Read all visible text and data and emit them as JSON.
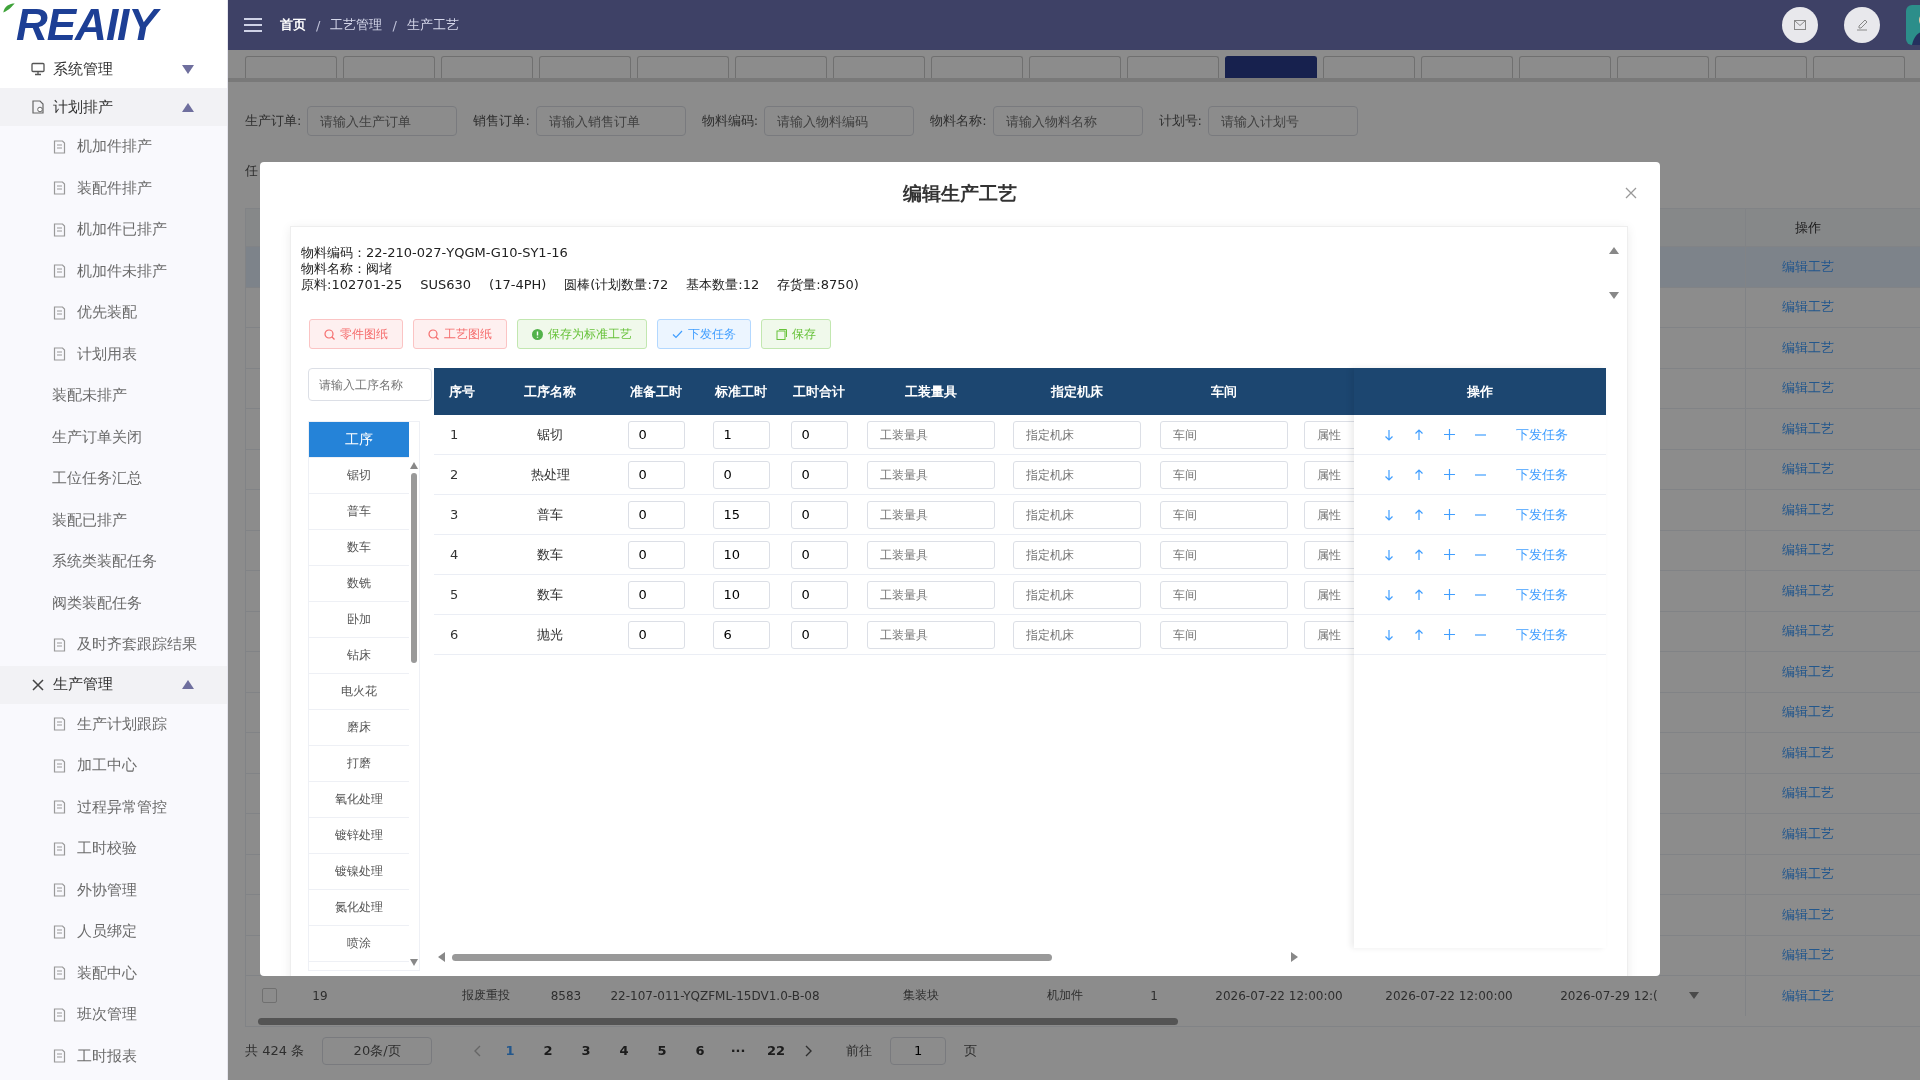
{
  "sidebar": {
    "logo": "REAIIY",
    "groups": [
      {
        "label": "系统管理",
        "expanded": false
      },
      {
        "label": "计划排产",
        "expanded": true,
        "items": [
          {
            "label": "机加件排产",
            "has_icon": true
          },
          {
            "label": "装配件排产",
            "has_icon": true
          },
          {
            "label": "机加件已排产",
            "has_icon": true
          },
          {
            "label": "机加件未排产",
            "has_icon": true
          },
          {
            "label": "优先装配",
            "has_icon": true
          },
          {
            "label": "计划用表",
            "has_icon": true
          },
          {
            "label": "装配未排产",
            "has_icon": false
          },
          {
            "label": "生产订单关闭",
            "has_icon": false
          },
          {
            "label": "工位任务汇总",
            "has_icon": false
          },
          {
            "label": "装配已排产",
            "has_icon": false
          },
          {
            "label": "系统类装配任务",
            "has_icon": false
          },
          {
            "label": "阀类装配任务",
            "has_icon": false
          },
          {
            "label": "及时齐套跟踪结果",
            "has_icon": true
          }
        ]
      },
      {
        "label": "生产管理",
        "expanded": true,
        "items": [
          {
            "label": "生产计划跟踪",
            "has_icon": true
          },
          {
            "label": "加工中心",
            "has_icon": true
          },
          {
            "label": "过程异常管控",
            "has_icon": true
          },
          {
            "label": "工时校验",
            "has_icon": true
          },
          {
            "label": "外协管理",
            "has_icon": true
          },
          {
            "label": "人员绑定",
            "has_icon": true
          },
          {
            "label": "装配中心",
            "has_icon": true
          },
          {
            "label": "班次管理",
            "has_icon": true
          },
          {
            "label": "工时报表",
            "has_icon": true
          }
        ]
      }
    ]
  },
  "breadcrumbs": [
    "首页",
    "工艺管理",
    "生产工艺"
  ],
  "breadcrumb_separators": [
    "/",
    "/"
  ],
  "tabs": [
    {
      "selected": false
    },
    {
      "selected": false
    },
    {
      "selected": false
    },
    {
      "selected": false
    },
    {
      "selected": false
    },
    {
      "selected": false
    },
    {
      "selected": false
    },
    {
      "selected": false
    },
    {
      "selected": false
    },
    {
      "selected": false
    },
    {
      "selected": true
    },
    {
      "selected": false
    },
    {
      "selected": false
    },
    {
      "selected": false
    },
    {
      "selected": false
    },
    {
      "selected": false
    },
    {
      "selected": false
    }
  ],
  "filters": [
    {
      "label": "生产订单:",
      "placeholder": "请输入生产订单"
    },
    {
      "label": "销售订单:",
      "placeholder": "请输入销售订单"
    },
    {
      "label": "物料编码:",
      "placeholder": "请输入物料编码"
    },
    {
      "label": "物料名称:",
      "placeholder": "请输入物料名称"
    },
    {
      "label": "计划号:",
      "placeholder": "请输入计划号"
    }
  ],
  "filter_row_2_label": "任",
  "table": {
    "op_header": "操作",
    "rows": [
      {
        "selected": true,
        "action": "编辑工艺"
      },
      {
        "selected": false,
        "action": "编辑工艺"
      },
      {
        "selected": false,
        "action": "编辑工艺"
      },
      {
        "selected": false,
        "action": "编辑工艺"
      },
      {
        "selected": false,
        "action": "编辑工艺"
      },
      {
        "selected": false,
        "action": "编辑工艺"
      },
      {
        "selected": false,
        "action": "编辑工艺"
      },
      {
        "selected": false,
        "action": "编辑工艺"
      },
      {
        "selected": false,
        "action": "编辑工艺"
      },
      {
        "selected": false,
        "action": "编辑工艺"
      },
      {
        "selected": false,
        "action": "编辑工艺"
      },
      {
        "selected": false,
        "action": "编辑工艺"
      },
      {
        "selected": false,
        "action": "编辑工艺"
      },
      {
        "selected": false,
        "action": "编辑工艺"
      },
      {
        "selected": false,
        "action": "编辑工艺"
      },
      {
        "selected": false,
        "action": "编辑工艺"
      },
      {
        "selected": false,
        "action": "编辑工艺"
      },
      {
        "selected": false,
        "action": "编辑工艺"
      },
      {
        "selected": false,
        "action": "编辑工艺",
        "checked": false,
        "cells": [
          "19",
          "",
          "报废重投",
          "8583",
          "22-107-011-YQZFML-15DV1.0-B-08",
          "集装块",
          "机加件",
          "1",
          "2026-07-22 12:00:00",
          "2026-07-22 12:00:00",
          "2026-07-29 12:("
        ]
      }
    ]
  },
  "pagination": {
    "total": "共 424 条",
    "page_size": "20条/页",
    "pages": [
      {
        "label": "1",
        "selected": true
      },
      {
        "label": "2",
        "selected": false
      },
      {
        "label": "3",
        "selected": false
      },
      {
        "label": "4",
        "selected": false
      },
      {
        "label": "5",
        "selected": false
      },
      {
        "label": "6",
        "selected": false
      },
      {
        "label": "···",
        "selected": false
      },
      {
        "label": "22",
        "selected": false
      }
    ],
    "goto_label": "前往",
    "goto_value": "1",
    "page_suffix": "页"
  },
  "modal": {
    "title": "编辑生产工艺",
    "info_lines": [
      [
        "物料编码：22-210-027-YQGM-G10-SY1-16"
      ],
      [
        "物料名称：阀堵"
      ],
      [
        "原料:102701-25",
        "SUS630",
        "(17-4PH)",
        "圆棒(计划数量:72",
        "基本数量:12",
        "存货量:8750)"
      ]
    ],
    "buttons": [
      {
        "label": "零件图纸",
        "kind": "danger"
      },
      {
        "label": "工艺图纸",
        "kind": "danger"
      },
      {
        "label": "保存为标准工艺",
        "kind": "success"
      },
      {
        "label": "下发任务",
        "kind": "primary"
      },
      {
        "label": "保存",
        "kind": "success"
      }
    ],
    "process_search": {
      "placeholder": "请输入工序名称"
    },
    "process_list": [
      {
        "label": "工序",
        "selected": true
      },
      {
        "label": "锯切",
        "selected": false
      },
      {
        "label": "普车",
        "selected": false
      },
      {
        "label": "数车",
        "selected": false
      },
      {
        "label": "数铣",
        "selected": false
      },
      {
        "label": "卧加",
        "selected": false
      },
      {
        "label": "钻床",
        "selected": false
      },
      {
        "label": "电火花",
        "selected": false
      },
      {
        "label": "磨床",
        "selected": false
      },
      {
        "label": "打磨",
        "selected": false
      },
      {
        "label": "氧化处理",
        "selected": false
      },
      {
        "label": "镀锌处理",
        "selected": false
      },
      {
        "label": "镀镍处理",
        "selected": false
      },
      {
        "label": "氮化处理",
        "selected": false
      },
      {
        "label": "喷涂",
        "selected": false
      }
    ],
    "columns": [
      "序号",
      "工序名称",
      "准备工时",
      "标准工时",
      "工时合计",
      "工装量具",
      "指定机床",
      "车间"
    ],
    "op_column": "操作",
    "rows": [
      {
        "seq": "1",
        "name": "锯切",
        "prep": "0",
        "std": "1",
        "total": "0",
        "tool_placeholder": "工装量具",
        "machine_placeholder": "指定机床",
        "workshop_placeholder": "车间",
        "attr_placeholder": "属性",
        "action": "下发任务"
      },
      {
        "seq": "2",
        "name": "热处理",
        "prep": "0",
        "std": "0",
        "total": "0",
        "tool_placeholder": "工装量具",
        "machine_placeholder": "指定机床",
        "workshop_placeholder": "车间",
        "attr_placeholder": "属性",
        "action": "下发任务"
      },
      {
        "seq": "3",
        "name": "普车",
        "prep": "0",
        "std": "15",
        "total": "0",
        "tool_placeholder": "工装量具",
        "machine_placeholder": "指定机床",
        "workshop_placeholder": "车间",
        "attr_placeholder": "属性",
        "action": "下发任务"
      },
      {
        "seq": "4",
        "name": "数车",
        "prep": "0",
        "std": "10",
        "total": "0",
        "tool_placeholder": "工装量具",
        "machine_placeholder": "指定机床",
        "workshop_placeholder": "车间",
        "attr_placeholder": "属性",
        "action": "下发任务"
      },
      {
        "seq": "5",
        "name": "数车",
        "prep": "0",
        "std": "10",
        "total": "0",
        "tool_placeholder": "工装量具",
        "machine_placeholder": "指定机床",
        "workshop_placeholder": "车间",
        "attr_placeholder": "属性",
        "action": "下发任务"
      },
      {
        "seq": "6",
        "name": "抛光",
        "prep": "0",
        "std": "6",
        "total": "0",
        "tool_placeholder": "工装量具",
        "machine_placeholder": "指定机床",
        "workshop_placeholder": "车间",
        "attr_placeholder": "属性",
        "action": "下发任务"
      }
    ]
  }
}
